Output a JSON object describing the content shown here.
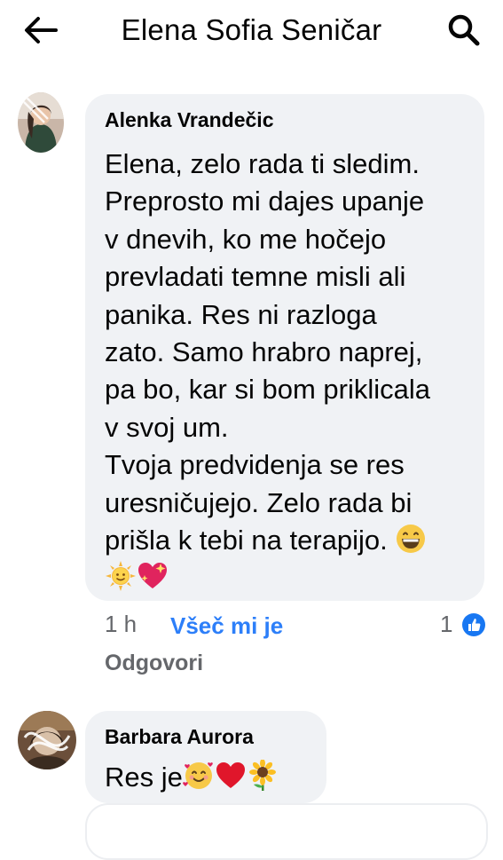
{
  "header": {
    "title": "Elena Sofia Seničar"
  },
  "comments": [
    {
      "author": "Alenka Vrandečic",
      "text": "Elena, zelo rada ti sledim.\nPreprosto mi dajes upanje\nv dnevih, ko me hočejo\nprevladati temne misli ali\npanika. Res ni razloga\nzato. Samo hrabro naprej,\npa bo, kar si bom priklicala\nv svoj um.\nTvoja predvidenja se res\nuresničujejo. Zelo rada bi\nprišla k tebi na terapijo.",
      "emojis": [
        "grinning-face",
        "sun-with-face",
        "sparkling-heart"
      ],
      "time": "1 h",
      "like_label": "Všeč mi je",
      "reply_label": "Odgovori",
      "reaction_count": "1"
    },
    {
      "author": "Barbara Aurora",
      "text": "Res je",
      "emojis": [
        "smiling-face-with-hearts",
        "red-heart",
        "sunflower"
      ]
    }
  ],
  "colors": {
    "bubble": "#f0f2f5",
    "link_blue": "#2d7ff9",
    "meta_gray": "#65676b"
  }
}
